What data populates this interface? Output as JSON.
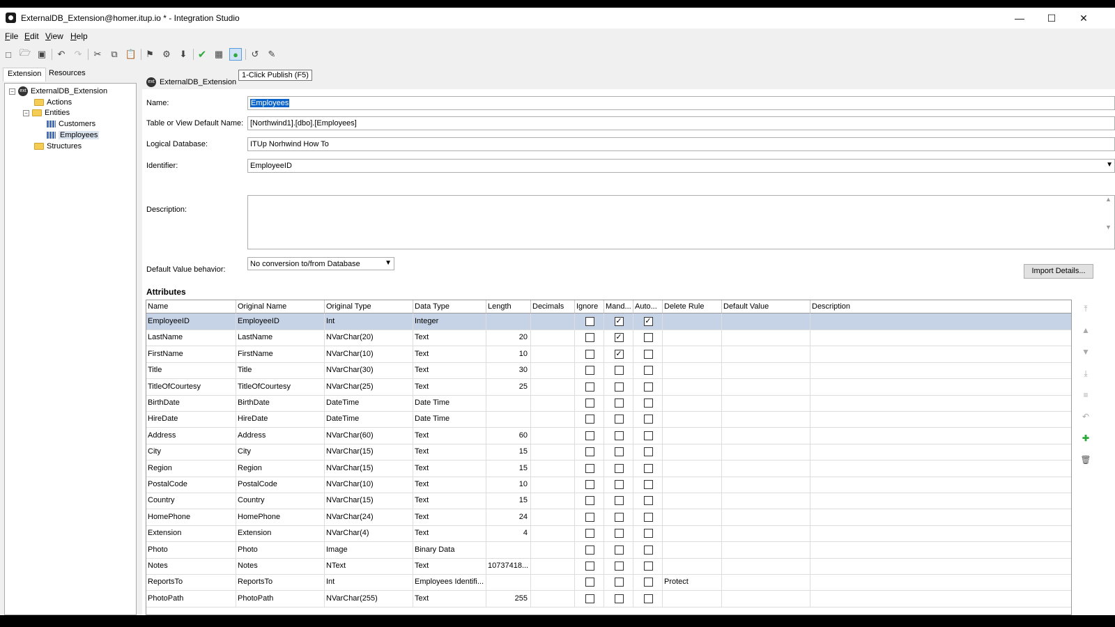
{
  "window": {
    "title": "ExternalDB_Extension@homer.itup.io * - Integration Studio",
    "minimize": "—",
    "maximize": "☐",
    "close": "✕"
  },
  "menu": [
    "File",
    "Edit",
    "View",
    "Help"
  ],
  "toolbar": {
    "tooltip": "1-Click Publish (F5)"
  },
  "left_tabs": {
    "extension": "Extension",
    "resources": "Resources"
  },
  "tree": {
    "root": "ExternalDB_Extension",
    "actions": "Actions",
    "entities": "Entities",
    "customers": "Customers",
    "employees": "Employees",
    "structures": "Structures"
  },
  "doc_tab": "ExternalDB_Extension",
  "form": {
    "name_label": "Name:",
    "name_value": "Employees",
    "table_label": "Table or View Default Name:",
    "table_value": "[Northwind1].[dbo].[Employees]",
    "logical_label": "Logical Database:",
    "logical_value": "ITUp Norhwind How To",
    "identifier_label": "Identifier:",
    "identifier_value": "EmployeeID",
    "description_label": "Description:",
    "dvb_label": "Default Value behavior:",
    "dvb_value": "No conversion to/from Database",
    "import_button": "Import Details..."
  },
  "attributes": {
    "title": "Attributes",
    "columns": [
      "Name",
      "Original Name",
      "Original Type",
      "Data Type",
      "Length",
      "Decimals",
      "Ignore",
      "Mand...",
      "Auto...",
      "Delete Rule",
      "Default Value",
      "Description"
    ],
    "rows": [
      {
        "name": "EmployeeID",
        "original_name": "EmployeeID",
        "original_type": "Int",
        "data_type": "Integer",
        "length": "",
        "ignore": false,
        "mandatory": true,
        "auto": true,
        "delete_rule": ""
      },
      {
        "name": "LastName",
        "original_name": "LastName",
        "original_type": "NVarChar(20)",
        "data_type": "Text",
        "length": "20",
        "ignore": false,
        "mandatory": true,
        "auto": false,
        "delete_rule": ""
      },
      {
        "name": "FirstName",
        "original_name": "FirstName",
        "original_type": "NVarChar(10)",
        "data_type": "Text",
        "length": "10",
        "ignore": false,
        "mandatory": true,
        "auto": false,
        "delete_rule": ""
      },
      {
        "name": "Title",
        "original_name": "Title",
        "original_type": "NVarChar(30)",
        "data_type": "Text",
        "length": "30",
        "ignore": false,
        "mandatory": false,
        "auto": false,
        "delete_rule": ""
      },
      {
        "name": "TitleOfCourtesy",
        "original_name": "TitleOfCourtesy",
        "original_type": "NVarChar(25)",
        "data_type": "Text",
        "length": "25",
        "ignore": false,
        "mandatory": false,
        "auto": false,
        "delete_rule": ""
      },
      {
        "name": "BirthDate",
        "original_name": "BirthDate",
        "original_type": "DateTime",
        "data_type": "Date Time",
        "length": "",
        "ignore": false,
        "mandatory": false,
        "auto": false,
        "delete_rule": ""
      },
      {
        "name": "HireDate",
        "original_name": "HireDate",
        "original_type": "DateTime",
        "data_type": "Date Time",
        "length": "",
        "ignore": false,
        "mandatory": false,
        "auto": false,
        "delete_rule": ""
      },
      {
        "name": "Address",
        "original_name": "Address",
        "original_type": "NVarChar(60)",
        "data_type": "Text",
        "length": "60",
        "ignore": false,
        "mandatory": false,
        "auto": false,
        "delete_rule": ""
      },
      {
        "name": "City",
        "original_name": "City",
        "original_type": "NVarChar(15)",
        "data_type": "Text",
        "length": "15",
        "ignore": false,
        "mandatory": false,
        "auto": false,
        "delete_rule": ""
      },
      {
        "name": "Region",
        "original_name": "Region",
        "original_type": "NVarChar(15)",
        "data_type": "Text",
        "length": "15",
        "ignore": false,
        "mandatory": false,
        "auto": false,
        "delete_rule": ""
      },
      {
        "name": "PostalCode",
        "original_name": "PostalCode",
        "original_type": "NVarChar(10)",
        "data_type": "Text",
        "length": "10",
        "ignore": false,
        "mandatory": false,
        "auto": false,
        "delete_rule": ""
      },
      {
        "name": "Country",
        "original_name": "Country",
        "original_type": "NVarChar(15)",
        "data_type": "Text",
        "length": "15",
        "ignore": false,
        "mandatory": false,
        "auto": false,
        "delete_rule": ""
      },
      {
        "name": "HomePhone",
        "original_name": "HomePhone",
        "original_type": "NVarChar(24)",
        "data_type": "Text",
        "length": "24",
        "ignore": false,
        "mandatory": false,
        "auto": false,
        "delete_rule": ""
      },
      {
        "name": "Extension",
        "original_name": "Extension",
        "original_type": "NVarChar(4)",
        "data_type": "Text",
        "length": "4",
        "ignore": false,
        "mandatory": false,
        "auto": false,
        "delete_rule": ""
      },
      {
        "name": "Photo",
        "original_name": "Photo",
        "original_type": "Image",
        "data_type": "Binary Data",
        "length": "",
        "ignore": false,
        "mandatory": false,
        "auto": false,
        "delete_rule": ""
      },
      {
        "name": "Notes",
        "original_name": "Notes",
        "original_type": "NText",
        "data_type": "Text",
        "length": "10737418...",
        "ignore": false,
        "mandatory": false,
        "auto": false,
        "delete_rule": ""
      },
      {
        "name": "ReportsTo",
        "original_name": "ReportsTo",
        "original_type": "Int",
        "data_type": "Employees Identifi...",
        "length": "",
        "ignore": false,
        "mandatory": false,
        "auto": false,
        "delete_rule": "Protect"
      },
      {
        "name": "PhotoPath",
        "original_name": "PhotoPath",
        "original_type": "NVarChar(255)",
        "data_type": "Text",
        "length": "255",
        "ignore": false,
        "mandatory": false,
        "auto": false,
        "delete_rule": ""
      }
    ]
  },
  "colors": {
    "selection": "#0a63c8",
    "selected_row": "#c6d3e6",
    "publish_green": "#2eaa3c"
  }
}
